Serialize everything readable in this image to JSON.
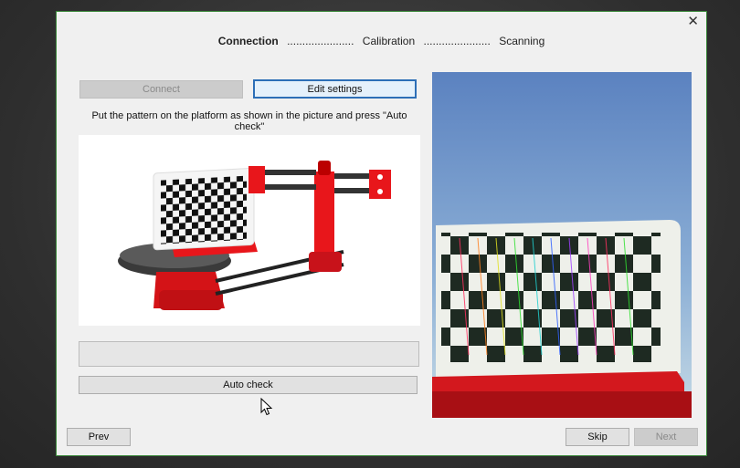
{
  "window": {
    "close_glyph": "✕"
  },
  "steps": {
    "connection": "Connection",
    "calibration": "Calibration",
    "scanning": "Scanning",
    "dots": "......................"
  },
  "buttons": {
    "connect": "Connect",
    "edit_settings": "Edit settings",
    "auto_check": "Auto check",
    "prev": "Prev",
    "skip": "Skip",
    "next": "Next"
  },
  "instruction": "Put the pattern on the platform as shown in the picture and press \"Auto check\"",
  "progress": {
    "value": 0
  },
  "icons": {
    "close": "close-icon",
    "scanner_illustration": "scanner-illustration",
    "camera_feed": "camera-feed",
    "cursor": "mouse-cursor-icon"
  },
  "colors": {
    "accent": "#2d6fb7",
    "scanner_red": "#e8161b",
    "dialog_border": "#3c8a3c"
  }
}
